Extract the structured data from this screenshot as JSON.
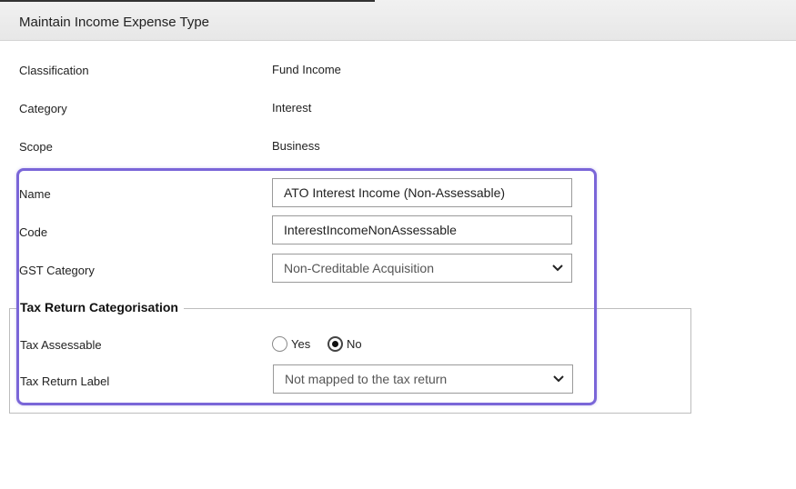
{
  "header": {
    "title": "Maintain Income Expense Type"
  },
  "info": {
    "classification_label": "Classification",
    "classification_value": "Fund Income",
    "category_label": "Category",
    "category_value": "Interest",
    "scope_label": "Scope",
    "scope_value": "Business"
  },
  "form": {
    "name_label": "Name",
    "name_value": "ATO Interest Income (Non-Assessable)",
    "code_label": "Code",
    "code_value": "InterestIncomeNonAssessable",
    "gst_label": "GST Category",
    "gst_value": "Non-Creditable Acquisition"
  },
  "tax": {
    "section_title": "Tax Return Categorisation",
    "assessable_label": "Tax Assessable",
    "yes_label": "Yes",
    "no_label": "No",
    "selected": "No",
    "label_label": "Tax Return Label",
    "label_value": "Not mapped to the tax return"
  },
  "colors": {
    "highlight": "#7a66d8"
  },
  "icons": {
    "dropdown": "chevron-down-icon"
  }
}
